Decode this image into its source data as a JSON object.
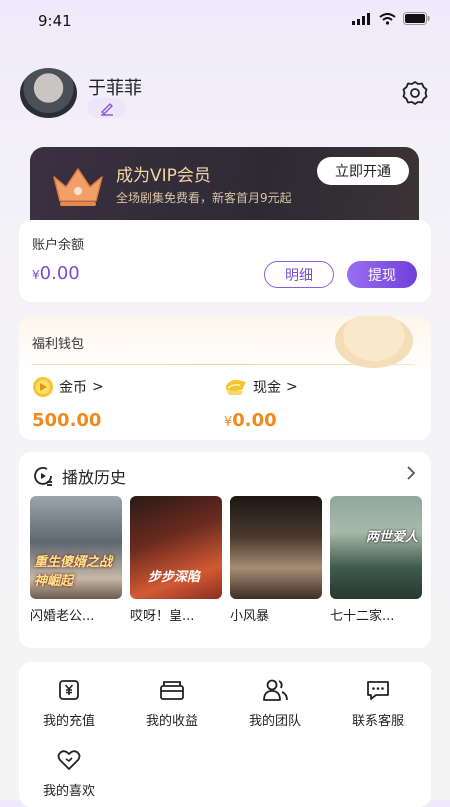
{
  "status_bar": {
    "time": "9:41"
  },
  "profile": {
    "username": "于菲菲"
  },
  "vip_banner": {
    "title": "成为VIP会员",
    "subtitle": "全场剧集免费看，新客首月9元起",
    "button": "立即开通"
  },
  "account": {
    "label": "账户余额",
    "currency": "¥",
    "amount": "0.00",
    "details_button": "明细",
    "withdraw_button": "提现"
  },
  "wallet": {
    "label": "福利钱包",
    "coins": {
      "label": "金币",
      "arrow": ">",
      "value": "500.00"
    },
    "cash": {
      "label": "现金",
      "arrow": ">",
      "currency": "¥",
      "value": "0.00"
    }
  },
  "history": {
    "title": "播放历史",
    "items": [
      {
        "caption": "闪婚老公...",
        "overlay": "重生傻婿之战神崛起"
      },
      {
        "caption": "哎呀！皇...",
        "overlay": "步步深陷"
      },
      {
        "caption": "小风暴",
        "overlay": ""
      },
      {
        "caption": "七十二家...",
        "overlay": "两世爱人"
      }
    ]
  },
  "menu": {
    "items": [
      {
        "label": "我的充值",
        "icon": "yen-card-icon"
      },
      {
        "label": "我的收益",
        "icon": "wallet-icon"
      },
      {
        "label": "我的团队",
        "icon": "team-icon"
      },
      {
        "label": "联系客服",
        "icon": "chat-icon"
      },
      {
        "label": "我的喜欢",
        "icon": "heart-icon"
      }
    ]
  },
  "colors": {
    "accent": "#7b4fd0",
    "coin": "#f08a1f",
    "vip_text": "#f2d6a6"
  }
}
